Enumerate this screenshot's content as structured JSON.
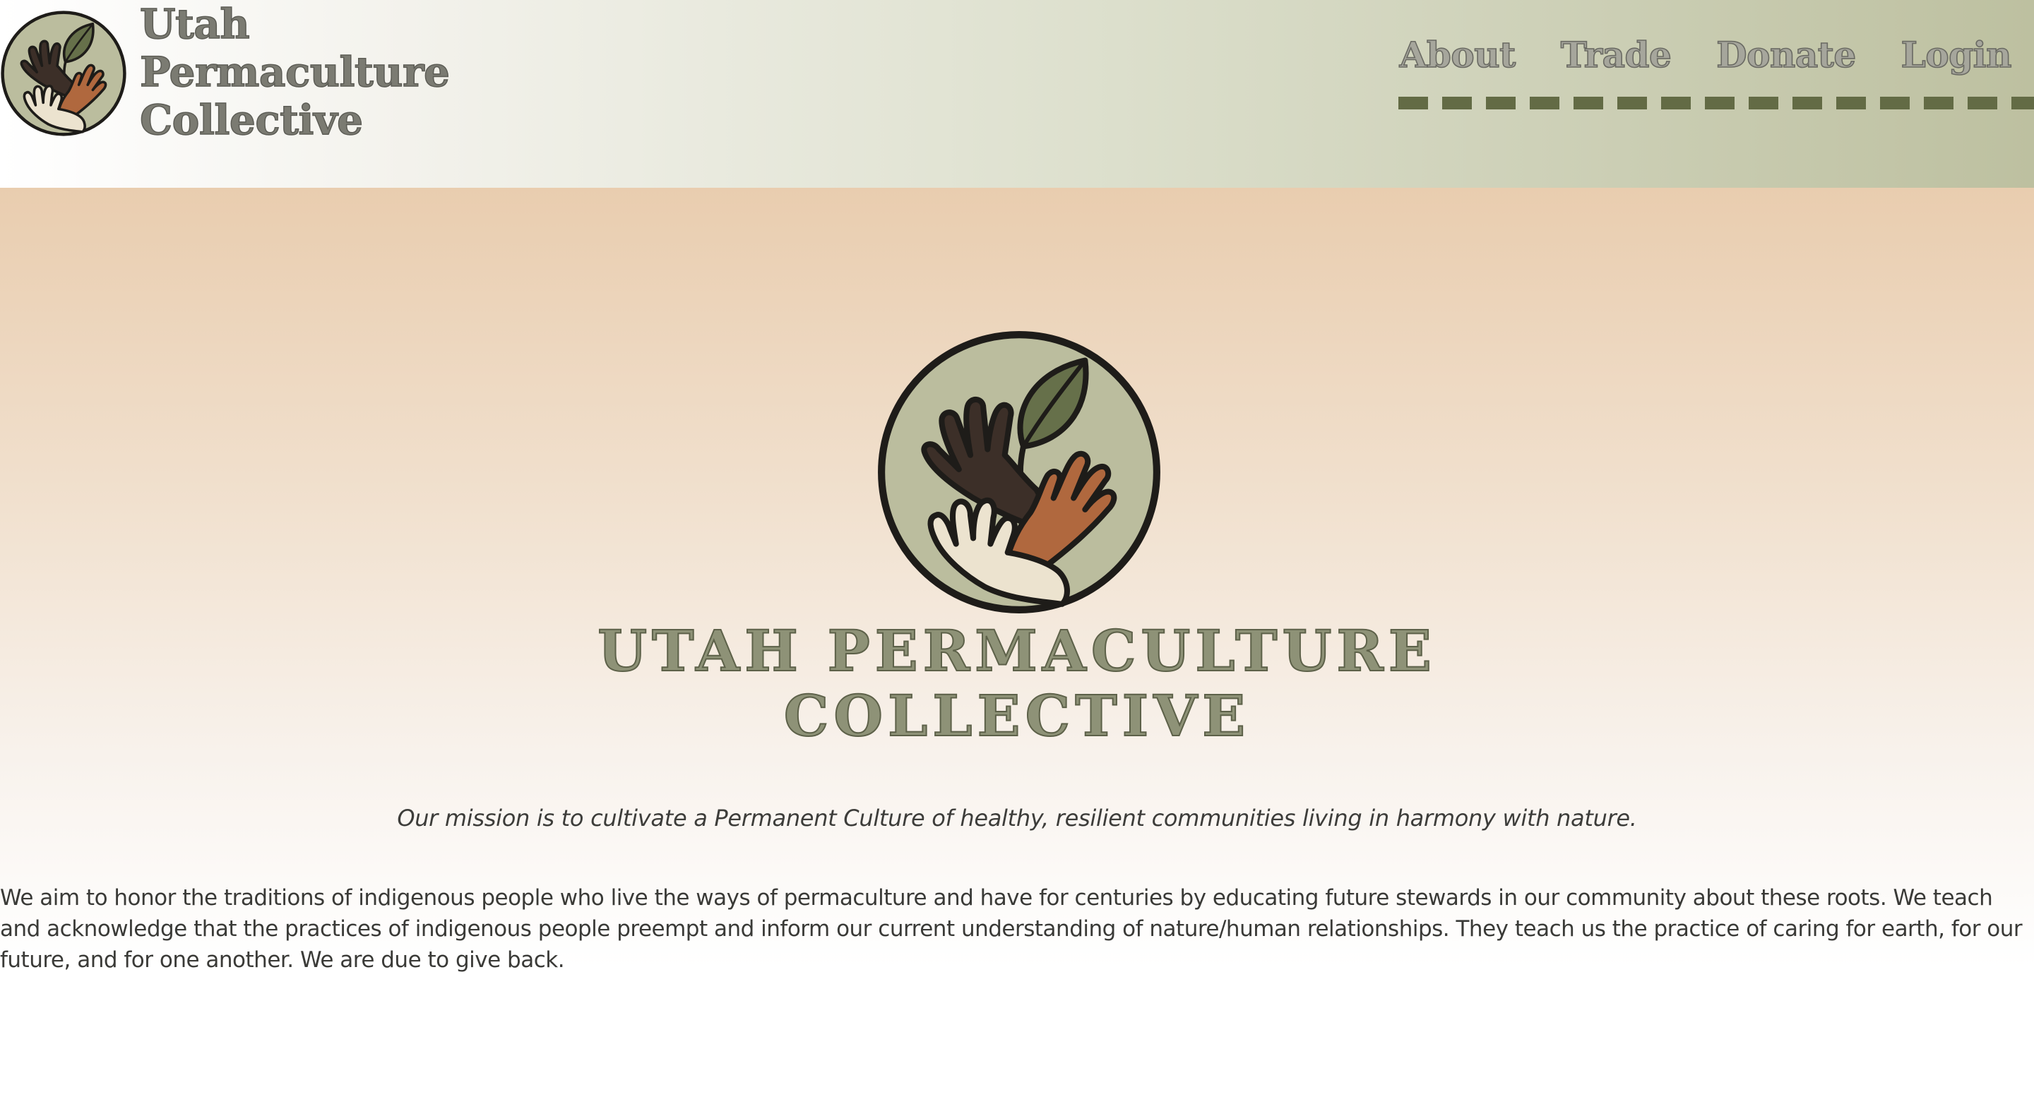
{
  "brand": {
    "name_lines": [
      "Utah",
      "Permaculture",
      "Collective"
    ]
  },
  "nav": {
    "items": [
      {
        "label": "About"
      },
      {
        "label": "Trade"
      },
      {
        "label": "Donate"
      },
      {
        "label": "Login"
      }
    ]
  },
  "hero": {
    "title_lines": [
      "UTAH PERMACULTURE",
      "COLLECTIVE"
    ],
    "logo_icon": "hands-holding-leaf-icon"
  },
  "mission": "Our mission is to cultivate a Permanent Culture of healthy, resilient communities living in harmony with nature.",
  "body": "We aim to honor the traditions of indigenous people who live the ways of permaculture and have for centuries by educating future stewards in our community about these roots. We teach and acknowledge that the practices of indigenous people preempt and inform our current understanding of nature/human relationships. They teach us the practice of caring for earth, for our future, and for one another. We are due to give back.",
  "colors": {
    "olive": "#636b45",
    "sage": "#bbbd9e",
    "clay": "#b0683e",
    "dark_hand": "#3c2f28",
    "light_hand": "#ece3cf",
    "peach": "#e9cdaf"
  }
}
